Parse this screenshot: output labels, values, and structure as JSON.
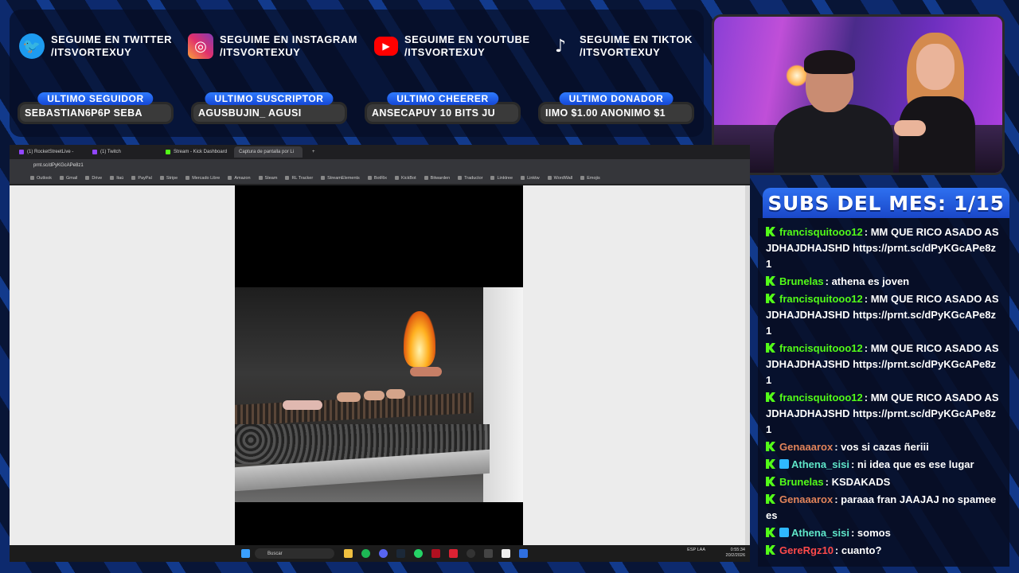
{
  "social": [
    {
      "icon": "twitter-icon",
      "glyph": "🐦",
      "line1": "SEGUIME EN TWITTER",
      "line2": "/ITSVORTEXUY"
    },
    {
      "icon": "instagram-icon",
      "glyph": "◎",
      "line1": "SEGUIME EN INSTAGRAM",
      "line2": "/ITSVORTEXUY"
    },
    {
      "icon": "youtube-icon",
      "glyph": "▶",
      "line1": "SEGUIME EN YOUTUBE",
      "line2": "/ITSVORTEXUY"
    },
    {
      "icon": "tiktok-icon",
      "glyph": "♪",
      "line1": "SEGUIME EN TIKTOK",
      "line2": "/ITSVORTEXUY"
    }
  ],
  "stats": [
    {
      "label": "ULTIMO SEGUIDOR",
      "value": "SEBASTIAN6P6P        SEBA"
    },
    {
      "label": "ULTIMO SUSCRIPTOR",
      "value": "  AGUSBUJIN_          AGUSI"
    },
    {
      "label": "ULTIMO CHEERER",
      "value": "ANSECAPUY 10 BITS       JU"
    },
    {
      "label": "ULTIMO DONADOR",
      "value": "IIMO $1.00      ANONIMO $1"
    }
  ],
  "subs_title": "SUBS DEL MES: 1/15",
  "chat": [
    {
      "user": "francisquitooo12",
      "color": "#53fc18",
      "text": ": MM QUE RICO ASADO ASJDHAJDHAJSHD https://prnt.sc/dPyKGcAPe8z1"
    },
    {
      "user": "Brunelas",
      "color": "#53fc18",
      "text": ": athena es joven"
    },
    {
      "user": "francisquitooo12",
      "color": "#53fc18",
      "text": ": MM QUE RICO ASADO ASJDHAJDHAJSHD https://prnt.sc/dPyKGcAPe8z1"
    },
    {
      "user": "francisquitooo12",
      "color": "#53fc18",
      "text": ": MM QUE RICO ASADO ASJDHAJDHAJSHD https://prnt.sc/dPyKGcAPe8z1"
    },
    {
      "user": "francisquitooo12",
      "color": "#53fc18",
      "text": ": MM QUE RICO ASADO ASJDHAJDHAJSHD https://prnt.sc/dPyKGcAPe8z1"
    },
    {
      "user": "Genaaarox",
      "color": "#e2845a",
      "text": ": vos si cazas ñeriii"
    },
    {
      "user": "Athena_sisi",
      "color": "#5fe6c8",
      "text": ": ni idea que es ese lugar",
      "extra": true
    },
    {
      "user": "Brunelas",
      "color": "#53fc18",
      "text": ": KSDAKADS"
    },
    {
      "user": "Genaaarox",
      "color": "#e2845a",
      "text": ": paraaa fran JAAJAJ no spameees"
    },
    {
      "user": "Athena_sisi",
      "color": "#5fe6c8",
      "text": ": somos",
      "extra": true
    },
    {
      "user": "GereRgz10",
      "color": "#ff4a4a",
      "text": ": cuanto?"
    }
  ],
  "browser": {
    "tabs": [
      "(1) RocketStreetLive -",
      "(1) Twitch",
      "Stream - Kick Dashboard",
      "Captura de pantalla por Li"
    ],
    "url": "prnt.sc/dPyKGcAPe8z1",
    "bookmarks": [
      "Outlook",
      "Gmail",
      "Drive",
      "Itaú",
      "PayPal",
      "Stripe",
      "Mercado Libre",
      "Amazon",
      "Steam",
      "RL Tracker",
      "StreamElements",
      "BotRix",
      "KickBot",
      "Bitwarden",
      "Traductor",
      "Linktree",
      "Linktw",
      "WordWall",
      "Emojis"
    ],
    "search_placeholder": "Buscar",
    "clock_time": "0:55:34",
    "clock_date": "20/2/2026",
    "lang": "ESP LAA"
  }
}
